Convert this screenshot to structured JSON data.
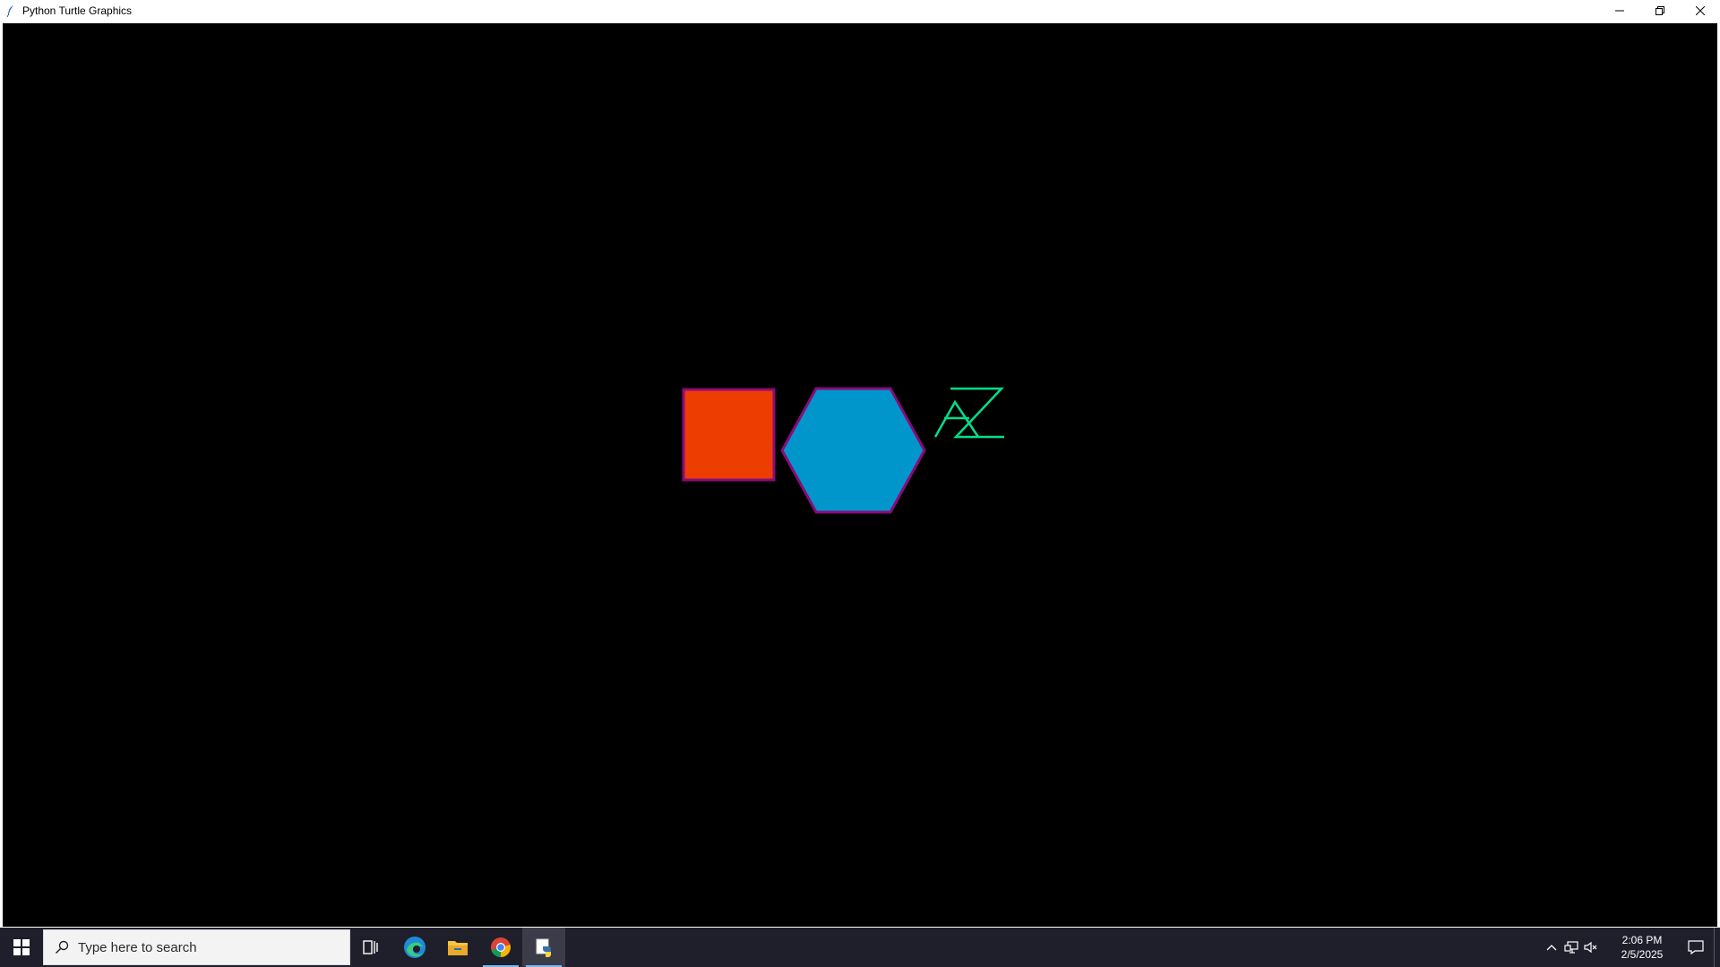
{
  "window": {
    "title": "Python Turtle Graphics",
    "controls": [
      "minimize",
      "restore",
      "close"
    ]
  },
  "canvas": {
    "background": "#000000",
    "shapes": [
      {
        "kind": "square",
        "fill": "#ee3d00",
        "stroke": "#8b0a7a"
      },
      {
        "kind": "hexagon",
        "fill": "#0096cc",
        "stroke": "#8b0a7a"
      },
      {
        "kind": "letters",
        "text": "AZ",
        "stroke": "#00e08a"
      }
    ]
  },
  "taskbar": {
    "search_placeholder": "Type here to search",
    "apps": [
      {
        "name": "task-view",
        "icon": "task-view-icon"
      },
      {
        "name": "edge",
        "icon": "edge-icon"
      },
      {
        "name": "file-explorer",
        "icon": "folder-icon"
      },
      {
        "name": "chrome",
        "icon": "chrome-icon",
        "active": true
      },
      {
        "name": "python",
        "icon": "python-icon",
        "active": true,
        "open": true
      }
    ],
    "clock": {
      "time": "2:06 PM",
      "date": "2/5/2025"
    }
  }
}
